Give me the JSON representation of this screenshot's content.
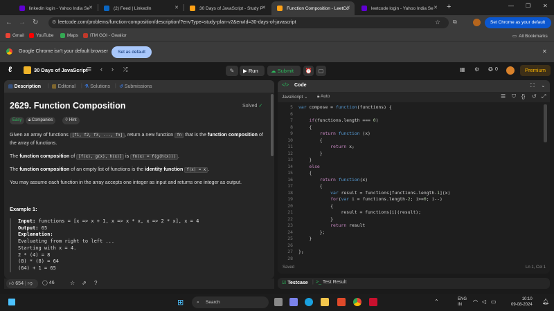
{
  "tabs": [
    {
      "label": "linkedin login - Yahoo India Se",
      "color": "#6001d2",
      "active": false
    },
    {
      "label": "(2) Feed | LinkedIn",
      "color": "#0a66c2",
      "active": false
    },
    {
      "label": "30 Days of JavaScript - Study P",
      "color": "#ffa116",
      "active": false
    },
    {
      "label": "Function Composition - LeetCo",
      "color": "#ffa116",
      "active": true
    },
    {
      "label": "leetcode login - Yahoo India Se",
      "color": "#6001d2",
      "active": false
    }
  ],
  "window_controls": {
    "minimize": "—",
    "restore": "❐",
    "close": "✕"
  },
  "address": {
    "url": "leetcode.com/problems/function-composition/description/?envType=study-plan-v2&envId=30-days-of-javascript"
  },
  "set_chrome_label": "Set Chrome as your default",
  "bookmarks": {
    "items": [
      {
        "label": "Gmail",
        "color": "#ea4335"
      },
      {
        "label": "YouTube",
        "color": "#ff0000"
      },
      {
        "label": "Maps",
        "color": "#34a853"
      },
      {
        "label": "ITM GOI - Gwalior",
        "color": "#c0392b"
      }
    ],
    "all_label": "All Bookmarks"
  },
  "infobar": {
    "message": "Google Chrome isn't your default browser",
    "button": "Set as default"
  },
  "lc_header": {
    "study_plan": "30 Days of JavaScript",
    "run": "Run",
    "submit": "Submit",
    "streak": "0",
    "premium": "Premium"
  },
  "left_tabs": {
    "description": "Description",
    "editorial": "Editorial",
    "solutions": "Solutions",
    "submissions": "Submissions"
  },
  "problem": {
    "title": "2629. Function Composition",
    "status": "Solved",
    "tag_easy": "Easy",
    "tag_companies": "Companies",
    "tag_hint": "Hint",
    "p1_a": "Given an array of functions ",
    "p1_code": "[f1, f2, f3, ..., fn]",
    "p1_b": ", return a new function ",
    "p1_code2": "fn",
    "p1_c": " that is the ",
    "p1_bold": "function composition",
    "p1_d": " of the array of functions.",
    "p2_a": "The ",
    "p2_bold": "function composition",
    "p2_b": " of ",
    "p2_code": "[f(x), g(x), h(x)]",
    "p2_c": " is ",
    "p2_code2": "fn(x) = f(g(h(x)))",
    "p2_d": ".",
    "p3_a": "The ",
    "p3_bold": "function composition",
    "p3_b": " of an empty list of functions is the ",
    "p3_bold2": "identity function",
    "p3_code": "f(x) = x",
    "p3_c": ".",
    "p4": "You may assume each function in the array accepts one integer as input and returns one integer as output.",
    "example_title": "Example 1:",
    "ex_input_label": "Input:",
    "ex_input": " functions = [x => x + 1, x => x * x, x => 2 * x], x = 4",
    "ex_output_label": "Output:",
    "ex_output": " 65",
    "ex_expl_label": "Explanation:",
    "ex_lines": [
      "Evaluating from right to left ...",
      "Starting with x = 4.",
      "2 * (4) = 8",
      "(8) * (8) = 64",
      "(64) + 1 = 65"
    ]
  },
  "left_footer": {
    "likes": "654",
    "comments": "46"
  },
  "code_panel": {
    "title": "Code",
    "language": "JavaScript",
    "mode": "Auto",
    "saved": "Saved",
    "cursor": "Ln 1, Col 1",
    "lines": [
      {
        "n": "5",
        "t": "var compose = function(functions) {"
      },
      {
        "n": "6",
        "t": ""
      },
      {
        "n": "7",
        "t": "    if(functions.length === 0)"
      },
      {
        "n": "8",
        "t": "    {"
      },
      {
        "n": "9",
        "t": "        return function (x)"
      },
      {
        "n": "10",
        "t": "        {"
      },
      {
        "n": "11",
        "t": "            return x;"
      },
      {
        "n": "12",
        "t": "        }"
      },
      {
        "n": "13",
        "t": "    }"
      },
      {
        "n": "14",
        "t": "    else"
      },
      {
        "n": "15",
        "t": "    {"
      },
      {
        "n": "16",
        "t": "        return function(x)"
      },
      {
        "n": "17",
        "t": "        {"
      },
      {
        "n": "18",
        "t": "            var result = functions[functions.length-1](x)"
      },
      {
        "n": "19",
        "t": "            for(var i = functions.length-2; i>=0; i--)"
      },
      {
        "n": "20",
        "t": "            {"
      },
      {
        "n": "21",
        "t": "                result = functions[i](result);"
      },
      {
        "n": "22",
        "t": "            }"
      },
      {
        "n": "23",
        "t": "            return result"
      },
      {
        "n": "24",
        "t": "        };"
      },
      {
        "n": "25",
        "t": "    }"
      },
      {
        "n": "26",
        "t": ""
      },
      {
        "n": "27",
        "t": "};"
      },
      {
        "n": "28",
        "t": ""
      }
    ]
  },
  "testcase": {
    "tab1": "Testcase",
    "tab2": "Test Result"
  },
  "taskbar": {
    "search": "Search",
    "lang_top": "ENG",
    "lang_bot": "IN",
    "time": "10:10",
    "date": "09-08-2024"
  }
}
